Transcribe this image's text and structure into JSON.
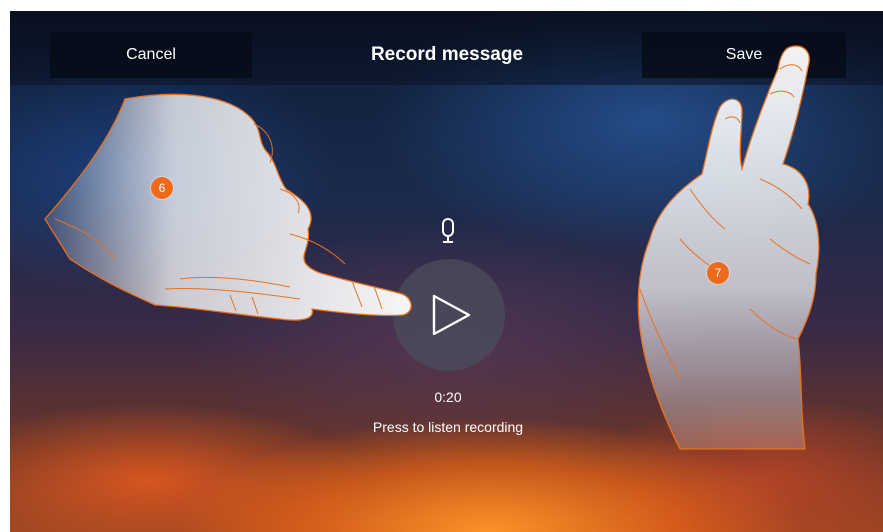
{
  "topbar": {
    "cancel_label": "Cancel",
    "title": "Record message",
    "save_label": "Save"
  },
  "player": {
    "time": "0:20",
    "hint": "Press to listen recording",
    "mic_icon": "microphone-icon",
    "play_icon": "play-icon"
  },
  "callouts": {
    "step_left": "6",
    "step_right": "7"
  },
  "colors": {
    "callout": "#ee6a1a",
    "hand_outline": "#e8711e",
    "button_background": "#0a1222",
    "text": "#ffffff"
  }
}
